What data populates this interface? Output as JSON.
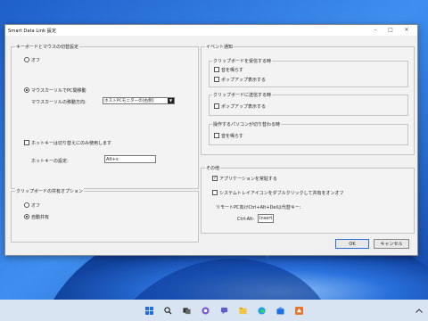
{
  "window": {
    "title": "Smart Data Link 設定"
  },
  "keyboard_group": {
    "title": "キーボードとマウスの切替設定",
    "off_label": "オフ",
    "mouse_move_label": "マウスカーソルでPC間移動",
    "direction_label": "マウスカーソルの移動方向:",
    "direction_value": "ホストPCモニターの[右側]",
    "hotkey_only_label": "ホットキーは切り替えにのみ使用します",
    "hotkey_label": "ホットキーの設定:",
    "hotkey_value": "Alt+s"
  },
  "clipboard_share_group": {
    "title": "クリップボードの共有オプション",
    "off_label": "オフ",
    "auto_label": "自動共有"
  },
  "event_group": {
    "title": "イベント通知",
    "receive": {
      "title": "クリップボードを受信する時",
      "sound": "音を鳴らす",
      "popup": "ポップアップ表示する"
    },
    "send": {
      "title": "クリップボードに送信する時",
      "popup": "ポップアップ表示する"
    },
    "switch": {
      "title": "操作するパソコンが切り替わる時",
      "sound": "音を鳴らす"
    }
  },
  "other_group": {
    "title": "その他",
    "resident_label": "アプリケーションを常駐する",
    "tray_label": "システムトレイアイコンをダブルクリックして共有をオンオフ",
    "remote_label": "リモートPC向けCtrl+Alt+Del以代替キー:",
    "key_left": "Ctrl-Alt-",
    "key_right": "Insert"
  },
  "buttons": {
    "ok": "OK",
    "cancel": "キャンセル"
  },
  "taskbar": {
    "icons": [
      "windows-start-icon",
      "search-icon",
      "task-view-icon",
      "widgets-icon",
      "chat-icon",
      "file-explorer-icon",
      "edge-browser-icon",
      "store-icon",
      "smart-data-link-icon"
    ],
    "accent": "#2d6fd6"
  }
}
